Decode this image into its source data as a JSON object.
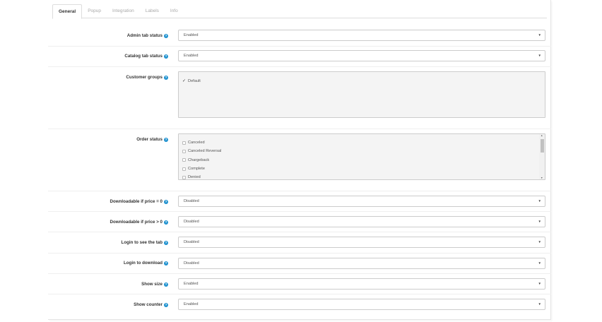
{
  "tabs": [
    "General",
    "Popup",
    "Integration",
    "Labels",
    "Info"
  ],
  "active_tab": "General",
  "fields": {
    "admin_tab_status": {
      "label": "Admin tab status",
      "value": "Enabled"
    },
    "catalog_tab_status": {
      "label": "Catalog tab status",
      "value": "Enabled"
    },
    "customer_groups": {
      "label": "Customer groups",
      "options": [
        "Default"
      ],
      "checked": [
        "Default"
      ]
    },
    "order_status": {
      "label": "Order status",
      "options": [
        "Canceled",
        "Canceled Reversal",
        "Chargeback",
        "Complete",
        "Denied"
      ]
    },
    "downloadable_price_zero": {
      "label": "Downloadable if price = 0",
      "value": "Disabled"
    },
    "downloadable_price_positive": {
      "label": "Downloadable if price > 0",
      "value": "Disabled"
    },
    "login_to_see_tab": {
      "label": "Login to see the tab",
      "value": "Disabled"
    },
    "login_to_download": {
      "label": "Login to download",
      "value": "Disabled"
    },
    "show_size": {
      "label": "Show size",
      "value": "Enabled"
    },
    "show_counter": {
      "label": "Show counter",
      "value": "Enabled"
    }
  },
  "icons": {
    "help": "question-circle-icon",
    "caret": "caret-down-icon",
    "check": "checkmark-icon"
  },
  "colors": {
    "help_icon": "#1e91cf",
    "border": "#cccccc",
    "box_bg": "#f4f4f4"
  }
}
